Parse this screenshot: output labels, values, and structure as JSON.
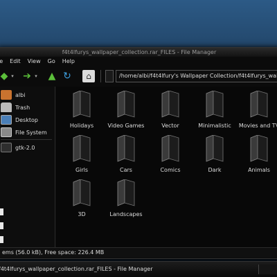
{
  "window": {
    "title": "f4t4lfurys_wallpaper_collection.rar_FILES - File Manager"
  },
  "menu": [
    "le",
    "Edit",
    "View",
    "Go",
    "Help"
  ],
  "toolbar": {
    "path": "/home/albi/f4t4lfury's Wallpaper Collection/f4t4lfurys_wallpap",
    "icons": {
      "back": "◆",
      "dropdown": "▾",
      "forward": "➔",
      "up": "▲",
      "reload": "↻",
      "home": "⌂"
    }
  },
  "sidebar": {
    "items": [
      {
        "label": "albi",
        "icon": "home-icon"
      },
      {
        "label": "Trash",
        "icon": "trash-icon"
      },
      {
        "label": "Desktop",
        "icon": "desktop-icon"
      },
      {
        "label": "File System",
        "icon": "filesystem-icon"
      },
      {
        "label": "gtk-2.0",
        "icon": "folder-icon"
      }
    ]
  },
  "folders": [
    "Holidays",
    "Video Games",
    "Vector",
    "Minimalistic",
    "Movies and TV",
    "Girls",
    "Cars",
    "Comics",
    "Dark",
    "Animals",
    "3D",
    "Landscapes"
  ],
  "status": "ems (56.0 kB), Free space: 226.4 MB",
  "taskbar": {
    "window_title": "f4t4lfurys_wallpaper_collection.rar_FILES - File Manager"
  }
}
